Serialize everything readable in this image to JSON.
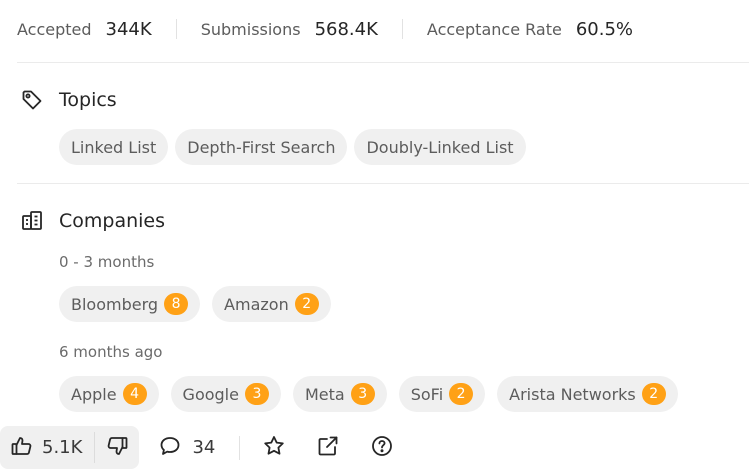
{
  "stats": [
    {
      "label": "Accepted",
      "value": "344K"
    },
    {
      "label": "Submissions",
      "value": "568.4K"
    },
    {
      "label": "Acceptance Rate",
      "value": "60.5%"
    }
  ],
  "topics": {
    "title": "Topics",
    "icon": "tag-icon",
    "tags": [
      "Linked List",
      "Depth-First Search",
      "Doubly-Linked List"
    ]
  },
  "companies": {
    "title": "Companies",
    "icon": "building-icon",
    "groups": [
      {
        "label": "0 - 3 months",
        "items": [
          {
            "name": "Bloomberg",
            "count": "8"
          },
          {
            "name": "Amazon",
            "count": "2"
          }
        ]
      },
      {
        "label": "6 months ago",
        "items": [
          {
            "name": "Apple",
            "count": "4"
          },
          {
            "name": "Google",
            "count": "3"
          },
          {
            "name": "Meta",
            "count": "3"
          },
          {
            "name": "SoFi",
            "count": "2"
          },
          {
            "name": "Arista Networks",
            "count": "2"
          }
        ]
      }
    ]
  },
  "bottom_bar": {
    "likes": "5.1K",
    "comments": "34",
    "icons": [
      "thumbs-up-icon",
      "thumbs-down-icon",
      "comment-icon",
      "star-icon",
      "share-icon",
      "help-icon"
    ]
  },
  "colors": {
    "badge": "#ffa116",
    "tag_bg": "#f0f0f0",
    "text": "#262626",
    "muted": "#5c5c5c"
  }
}
